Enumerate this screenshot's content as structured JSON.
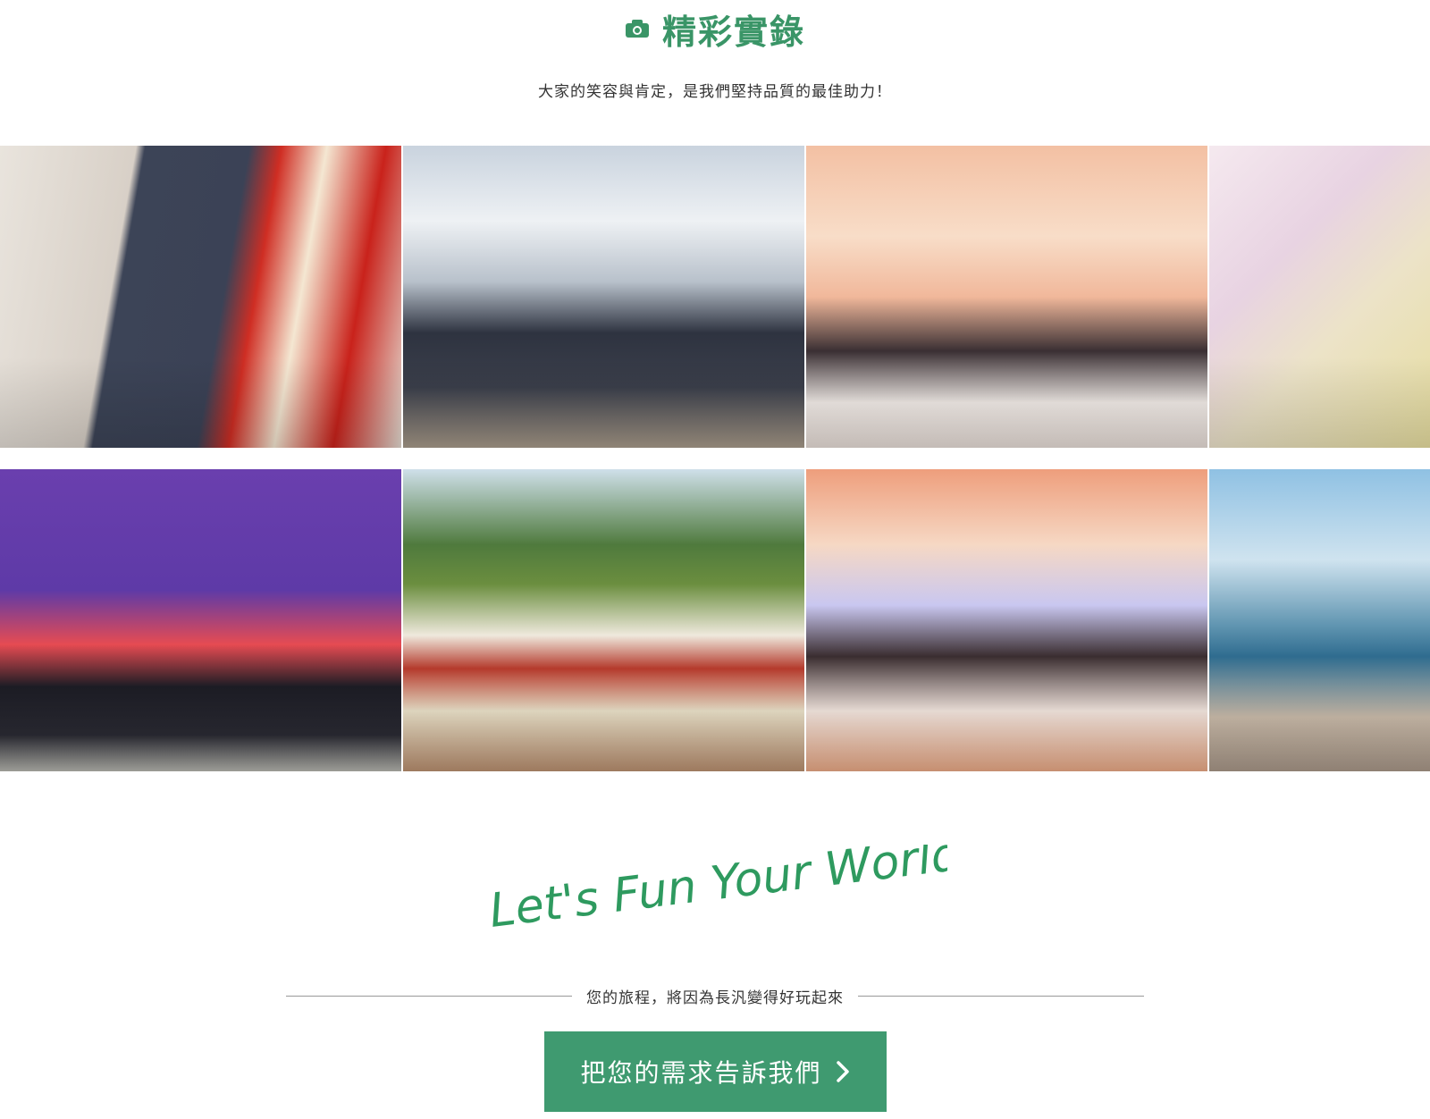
{
  "section": {
    "icon": "camera-icon",
    "title": "精彩實錄",
    "subtitle": "大家的笑容與肯定，是我們堅持品質的最佳助力！"
  },
  "gallery": {
    "photos": [
      {
        "name": "daruma-painting-photo"
      },
      {
        "name": "paris-group-photo"
      },
      {
        "name": "banquet-hall-photo"
      },
      {
        "name": "gift-detail-photo"
      },
      {
        "name": "masquerade-group-photo"
      },
      {
        "name": "costume-party-photo"
      },
      {
        "name": "stage-banquet-photo"
      },
      {
        "name": "beach-group-photo"
      }
    ]
  },
  "slogan": "Let's Fun Your World!",
  "tagline": "您的旅程，將因為長汎變得好玩起來",
  "cta": {
    "label": "把您的需求告訴我們",
    "icon": "chevron-right-icon"
  },
  "colors": {
    "brand_green": "#3a9567",
    "button_green": "#3f9a70"
  }
}
